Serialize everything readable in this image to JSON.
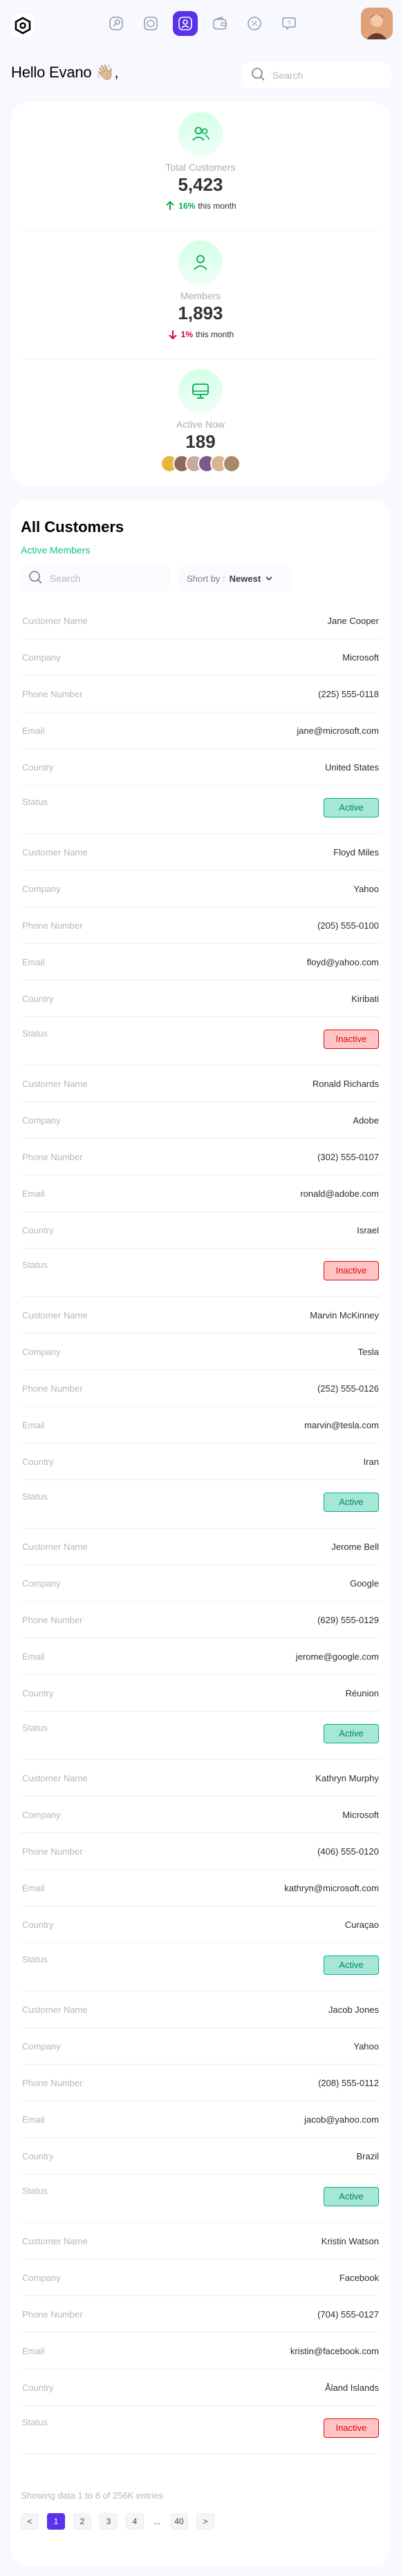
{
  "header": {
    "greeting": "Hello Evano 👋🏼,",
    "search_placeholder": "Search"
  },
  "nav": {
    "icons": [
      "key-icon",
      "cube-icon",
      "user-square-icon",
      "wallet-icon",
      "discount-icon",
      "message-question-icon"
    ],
    "active_index": 2
  },
  "stats": [
    {
      "label": "Total Customers",
      "value": "5,423",
      "trend_value": "16%",
      "trend_text": "this month",
      "direction": "up"
    },
    {
      "label": "Members",
      "value": "1,893",
      "trend_value": "1%",
      "trend_text": "this month",
      "direction": "down"
    },
    {
      "label": "Active Now",
      "value": "189"
    }
  ],
  "customers": {
    "title": "All Customers",
    "subtitle": "Active Members",
    "search_placeholder": "Search",
    "sort_label": "Short by :",
    "sort_value": "Newest",
    "field_labels": {
      "name": "Customer Name",
      "company": "Company",
      "phone": "Phone Number",
      "email": "Email",
      "country": "Country",
      "status": "Status"
    },
    "rows": [
      {
        "name": "Jane Cooper",
        "company": "Microsoft",
        "phone": "(225) 555-0118",
        "email": "jane@microsoft.com",
        "country": "United States",
        "status": "Active"
      },
      {
        "name": "Floyd Miles",
        "company": "Yahoo",
        "phone": "(205) 555-0100",
        "email": "floyd@yahoo.com",
        "country": "Kiribati",
        "status": "Inactive"
      },
      {
        "name": "Ronald Richards",
        "company": "Adobe",
        "phone": "(302) 555-0107",
        "email": "ronald@adobe.com",
        "country": "Israel",
        "status": "Inactive"
      },
      {
        "name": "Marvin McKinney",
        "company": "Tesla",
        "phone": "(252) 555-0126",
        "email": "marvin@tesla.com",
        "country": "Iran",
        "status": "Active"
      },
      {
        "name": "Jerome Bell",
        "company": "Google",
        "phone": "(629) 555-0129",
        "email": "jerome@google.com",
        "country": "Réunion",
        "status": "Active"
      },
      {
        "name": "Kathryn Murphy",
        "company": "Microsoft",
        "phone": "(406) 555-0120",
        "email": "kathryn@microsoft.com",
        "country": "Curaçao",
        "status": "Active"
      },
      {
        "name": "Jacob Jones",
        "company": "Yahoo",
        "phone": "(208) 555-0112",
        "email": "jacob@yahoo.com",
        "country": "Brazil",
        "status": "Active"
      },
      {
        "name": "Kristin Watson",
        "company": "Facebook",
        "phone": "(704) 555-0127",
        "email": "kristin@facebook.com",
        "country": "Åland Islands",
        "status": "Inactive"
      }
    ],
    "showing_text": "Showing data 1 to 8 of 256K entries",
    "pages": [
      "<",
      "1",
      "2",
      "3",
      "4",
      "...",
      "40",
      ">"
    ],
    "current_page": "1"
  },
  "colors": {
    "accent": "#5932ea",
    "active": "#00b087",
    "inactive": "#df0404",
    "up": "#00ac4f",
    "down": "#d0004b"
  }
}
